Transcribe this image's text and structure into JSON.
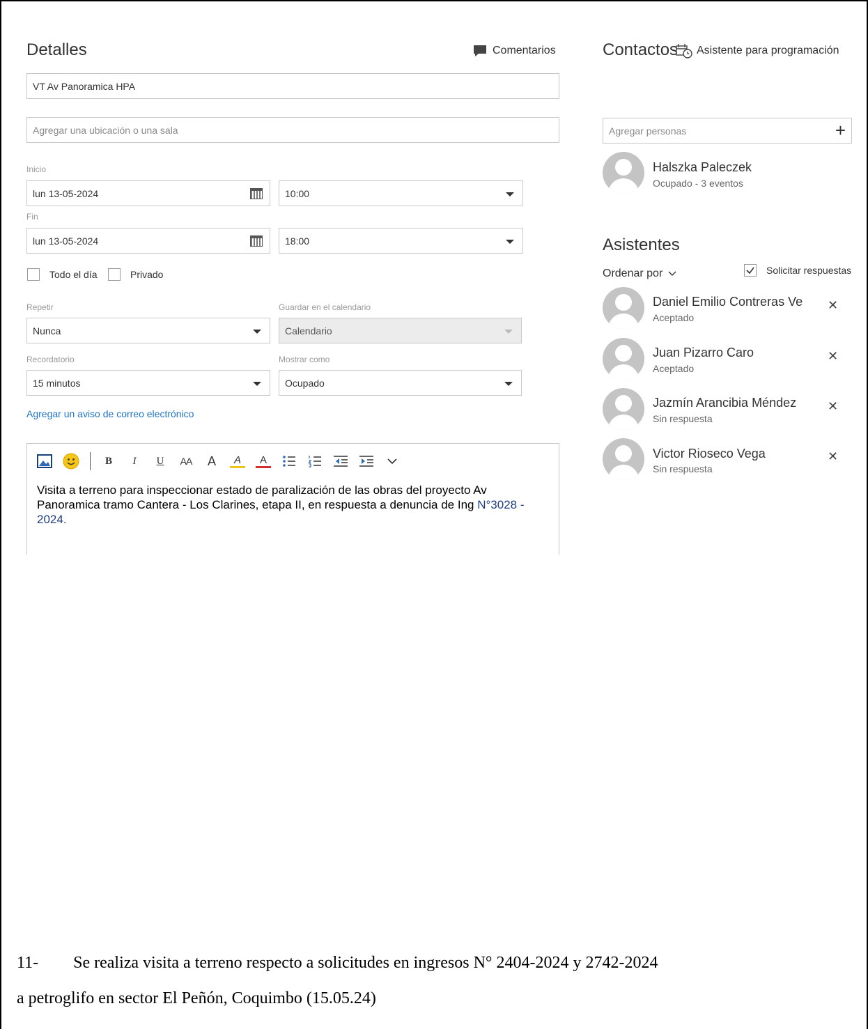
{
  "details": {
    "title": "Detalles",
    "comments_label": "Comentarios",
    "subject_value": "VT Av Panoramica HPA",
    "location_placeholder": "Agregar una ubicación o una sala",
    "start_label": "Inicio",
    "start_date": "lun 13-05-2024",
    "start_time": "10:00",
    "end_label": "Fin",
    "end_date": "lun 13-05-2024",
    "end_time": "18:00",
    "all_day_label": "Todo el día",
    "private_label": "Privado",
    "repeat_label": "Repetir",
    "repeat_value": "Nunca",
    "save_in_label": "Guardar en el calendario",
    "save_in_value": "Calendario",
    "reminder_label": "Recordatorio",
    "reminder_value": "15 minutos",
    "show_as_label": "Mostrar como",
    "show_as_value": "Ocupado",
    "email_reminder_link": "Agregar un aviso de correo electrónico"
  },
  "toolbar": {
    "bold": "B",
    "italic": "I",
    "underline": "U",
    "font_size": "AA",
    "grow_font": "A",
    "highlight": "A",
    "font_color": "A"
  },
  "body": {
    "text_main": "Visita a terreno para inspeccionar estado de paralización de las obras del proyecto Av Panoramica tramo Cantera - Los Clarines, etapa II, en respuesta a denuncia de Ing ",
    "text_ref": "N°3028  - 2024."
  },
  "contacts": {
    "title": "Contactos",
    "scheduling_assistant": "Asistente para programación",
    "add_people_placeholder": "Agregar personas",
    "organizer": {
      "name": "Halszka Paleczek",
      "status": "Ocupado - 3 eventos"
    }
  },
  "attendees": {
    "title": "Asistentes",
    "sort_by": "Ordenar por",
    "request_responses": "Solicitar respuestas",
    "list": [
      {
        "name": "Daniel Emilio Contreras Ve",
        "status": "Aceptado"
      },
      {
        "name": "Juan Pizarro Caro",
        "status": "Aceptado"
      },
      {
        "name": "Jazmín Arancibia Méndez",
        "status": "Sin respuesta"
      },
      {
        "name": "Victor Rioseco Vega",
        "status": "Sin respuesta"
      }
    ]
  },
  "footer": {
    "line1_num": "11-",
    "line1_text": "Se realiza visita a terreno respecto a solicitudes en ingresos N° 2404-2024 y 2742-2024",
    "line2": "a petroglifo en sector El Peñón, Coquimbo (15.05.24)"
  }
}
